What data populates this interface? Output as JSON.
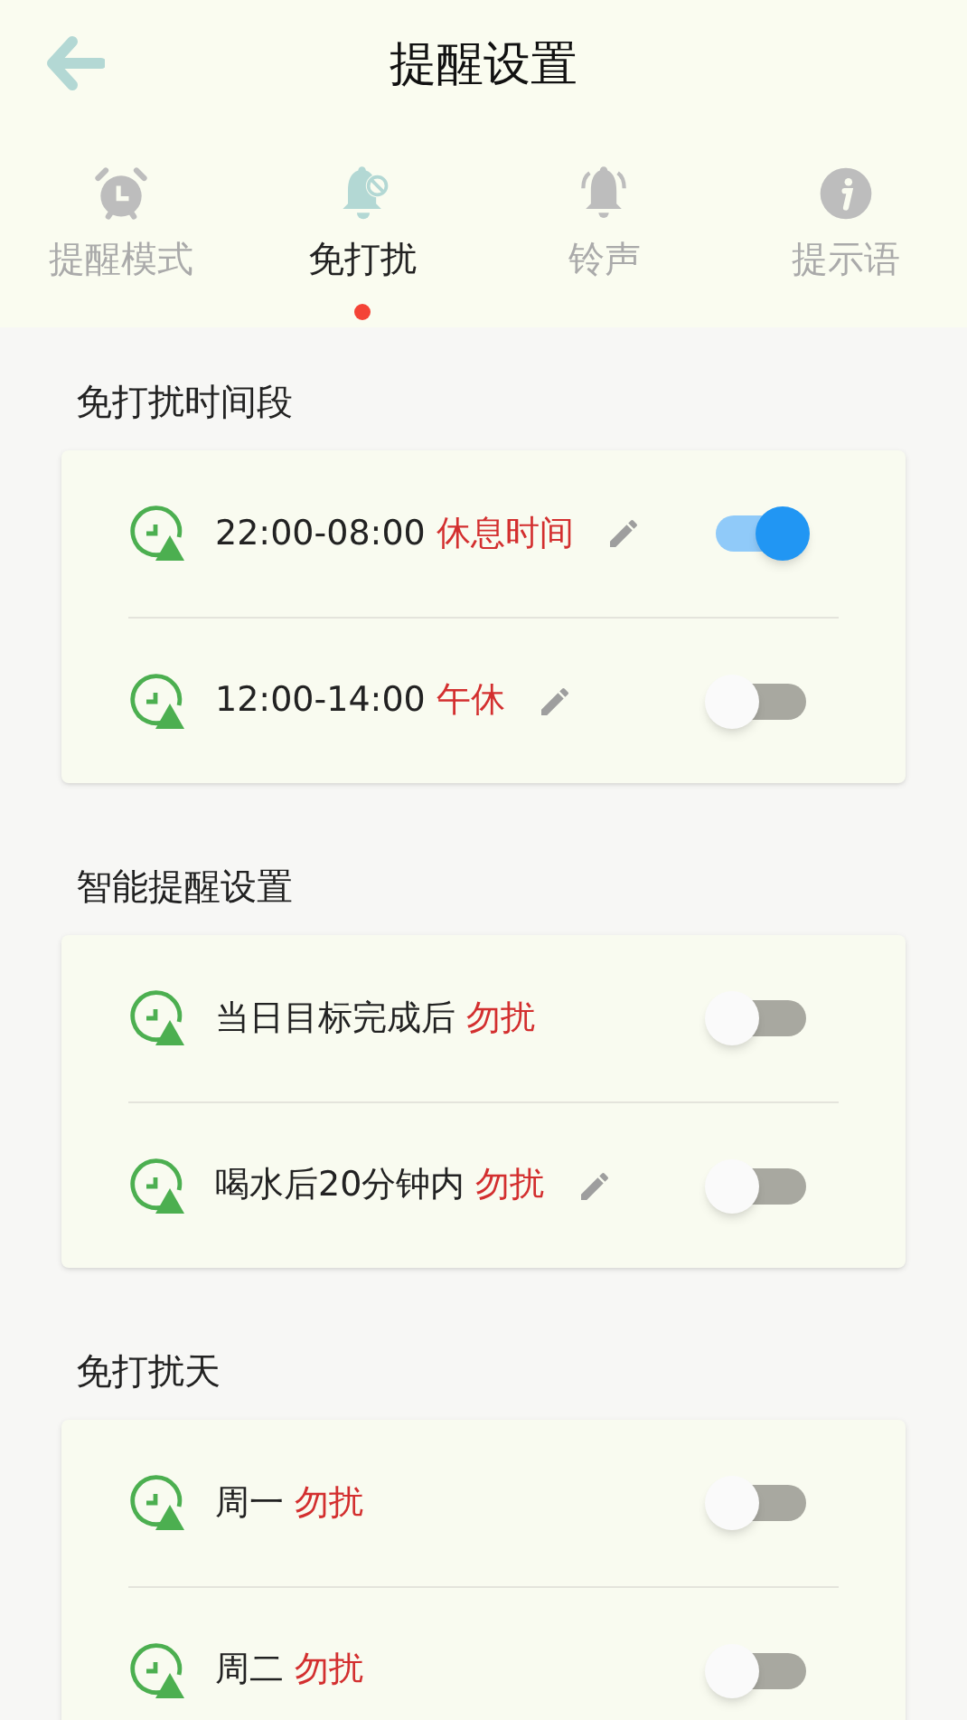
{
  "header": {
    "title": "提醒设置"
  },
  "tabs": [
    {
      "label": "提醒模式",
      "kind": "alarm",
      "selected": false
    },
    {
      "label": "免打扰",
      "kind": "bell-off",
      "selected": true
    },
    {
      "label": "铃声",
      "kind": "bell",
      "selected": false
    },
    {
      "label": "提示语",
      "kind": "info",
      "selected": false
    }
  ],
  "sections": [
    {
      "title": "免打扰时间段",
      "rows": [
        {
          "text": "22:00-08:00",
          "tag": "休息时间",
          "editable": true,
          "on": true
        },
        {
          "text": "12:00-14:00",
          "tag": "午休",
          "editable": true,
          "on": false
        }
      ]
    },
    {
      "title": "智能提醒设置",
      "rows": [
        {
          "text": "当日目标完成后",
          "tag": "勿扰",
          "editable": false,
          "on": false
        },
        {
          "text": "喝水后20分钟内",
          "tag": "勿扰",
          "editable": true,
          "on": false
        }
      ]
    },
    {
      "title": "免打扰天",
      "rows": [
        {
          "text": "周一",
          "tag": "勿扰",
          "editable": false,
          "on": false
        },
        {
          "text": "周二",
          "tag": "勿扰",
          "editable": false,
          "on": false
        }
      ]
    }
  ]
}
